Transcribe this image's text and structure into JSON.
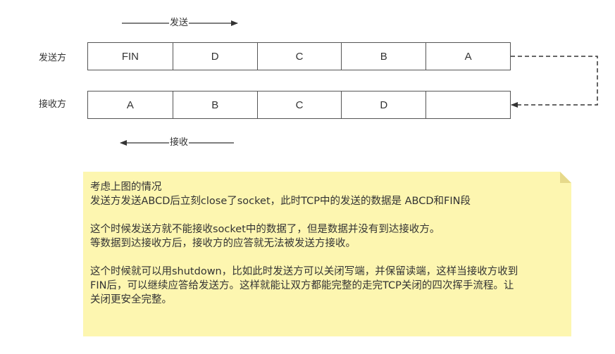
{
  "diagram": {
    "send_arrow_label": "发送",
    "receive_arrow_label": "接收",
    "sender_label": "发送方",
    "receiver_label": "接收方",
    "sender_cells": [
      "FIN",
      "D",
      "C",
      "B",
      "A"
    ],
    "receiver_cells": [
      "A",
      "B",
      "C",
      "D",
      ""
    ]
  },
  "note": {
    "paragraph1": [
      "考虑上图的情况",
      "发送方发送ABCD后立刻close了socket，此时TCP中的发送的数据是 ABCD和FIN段"
    ],
    "paragraph2": [
      "这个时候发送方就不能接收socket中的数据了，但是数据并没有到达接收方。",
      "等数据到达接收方后，接收方的应答就无法被发送方接收。"
    ],
    "paragraph3": [
      "这个时候就可以用shutdown，比如此时发送方可以关闭写端，并保留读端，这样当接收方收到",
      "FIN后，可以继续应答给发送方。这样就能让双方都能完整的走完TCP关闭的四次挥手流程。让",
      "关闭更安全完整。"
    ]
  },
  "colors": {
    "note_fill": "#fdf6b0",
    "note_fold": "#e6d98a",
    "line": "#333333",
    "border": "#555555"
  }
}
